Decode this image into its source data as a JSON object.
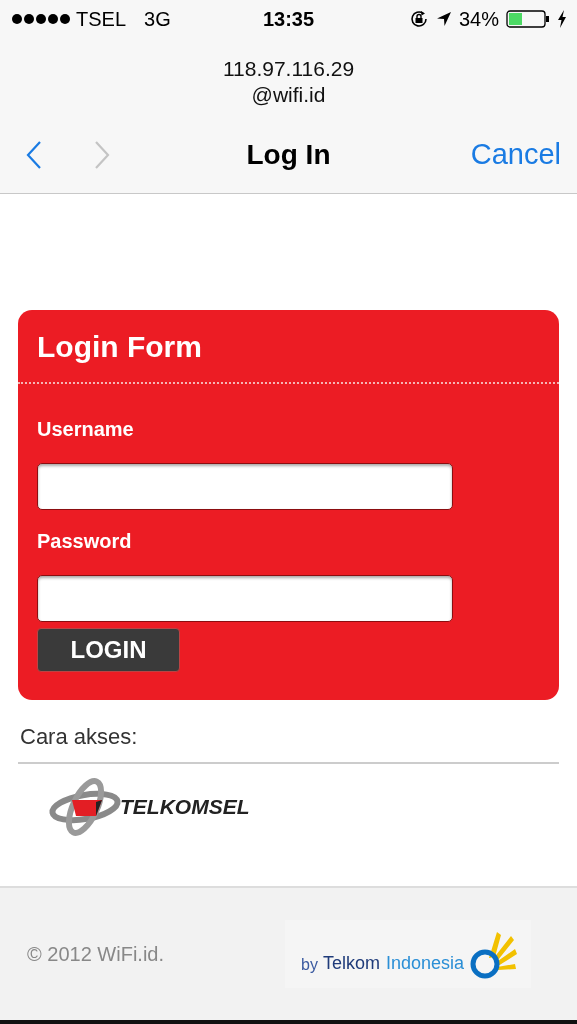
{
  "status_bar": {
    "carrier": "TSEL",
    "network": "3G",
    "time": "13:35",
    "battery": "34%"
  },
  "address": {
    "host": "118.97.116.29",
    "realm": "@wifi.id"
  },
  "nav": {
    "back": {
      "disabled": false
    },
    "forward": {
      "disabled": true
    },
    "title": "Log In",
    "cancel": "Cancel"
  },
  "form": {
    "title": "Login Form",
    "fields": [
      {
        "label": "Username"
      },
      {
        "label": "Password"
      }
    ],
    "button": "LOGIN"
  },
  "access": {
    "heading": "Cara akses:",
    "providers": [
      {
        "name": "TELKOMSEL"
      }
    ]
  },
  "footer": {
    "copyright": "© 2012 WiFi.id.",
    "badge": {
      "by": "by",
      "brand": "Telkom",
      "country": "Indonesia"
    }
  }
}
